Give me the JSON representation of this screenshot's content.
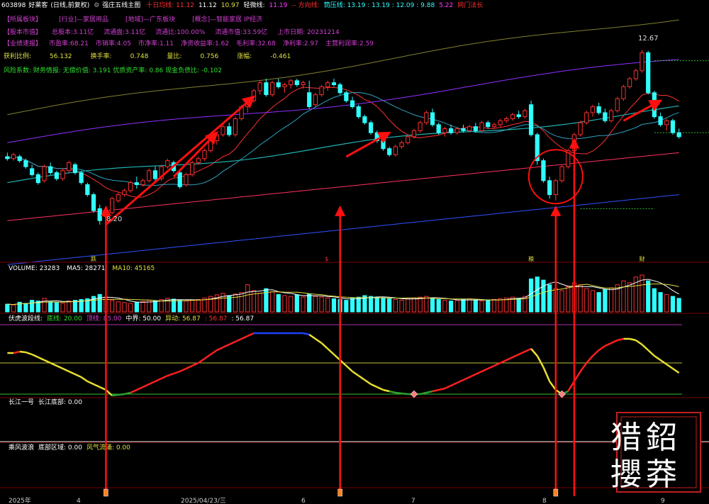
{
  "header": {
    "code": "603898",
    "name": "好莱客",
    "mode": "(日线,前复权)",
    "indicator": "强庄五线主图",
    "ma_items": [
      {
        "text": "十日均线: 11.12",
        "color": "#ff3030"
      },
      {
        "text": "11.12",
        "color": "#ffffff"
      },
      {
        "text": "10.97",
        "color": "#e0e040"
      },
      {
        "text": "轻微线:",
        "color": "#ffffff"
      },
      {
        "text": "11.19",
        "color": "#ff40ff"
      },
      {
        "text": "-- 方向线:",
        "color": "#ff3030"
      },
      {
        "text": "筒压线: 13.19 : 13.19 : 12.09 : 9.88",
        "color": "#30ffff"
      },
      {
        "text": "5.22",
        "color": "#ff40ff"
      },
      {
        "text": "网门法长",
        "color": "#ff3030"
      }
    ]
  },
  "info_rows": [
    [
      {
        "text": "【所属板块】",
        "color": "#d040d0"
      },
      {
        "text": "[行业]—家居用品",
        "color": "#d040d0"
      },
      {
        "text": "[地域]—广东板块",
        "color": "#d040d0"
      },
      {
        "text": "[概念]—智能家居 IP经济",
        "color": "#d040d0"
      }
    ],
    [
      {
        "text": "【股本市值】",
        "color": "#d040d0"
      },
      {
        "text": "总股本:3.11亿",
        "color": "#d040d0"
      },
      {
        "text": "流通盘:3.11亿",
        "color": "#d040d0"
      },
      {
        "text": "流通比:100.00%",
        "color": "#d040d0"
      },
      {
        "text": "流通市值:33.59亿",
        "color": "#d040d0"
      },
      {
        "text": "上市日期: 20231214",
        "color": "#d040d0"
      }
    ],
    [
      {
        "text": "【业绩速报】",
        "color": "#d040d0"
      },
      {
        "text": "市盈率:68.21",
        "color": "#d040d0"
      },
      {
        "text": "市销率:4.05",
        "color": "#d040d0"
      },
      {
        "text": "市净率:1.11",
        "color": "#d040d0"
      },
      {
        "text": "净资收益率:1.62",
        "color": "#d040d0"
      },
      {
        "text": "毛利率:32.68",
        "color": "#d040d0"
      },
      {
        "text": "净利率:2.97",
        "color": "#d040d0"
      },
      {
        "text": "主营利润率:2.59",
        "color": "#d040d0"
      }
    ],
    [
      {
        "text": "获利比例:",
        "color": "#e0e040"
      },
      {
        "text": "56.132",
        "color": "#e0e040"
      },
      {
        "text": "换手率:",
        "color": "#e0e040"
      },
      {
        "text": "0.748",
        "color": "#e0e040"
      },
      {
        "text": "量比:",
        "color": "#e0e040"
      },
      {
        "text": "0.756",
        "color": "#e0e040"
      },
      {
        "text": "涨幅:",
        "color": "#e0e040"
      },
      {
        "text": "-0.461",
        "color": "#e0e040"
      }
    ],
    [
      {
        "text": "风险系数: 财务情报: 无偿价值: 3.191 优质资产率: 0.86 现金负债比: -0.102",
        "color": "#30e030"
      }
    ]
  ],
  "price_labels": {
    "high": "12.67",
    "low": "8.20"
  },
  "volume_header": [
    {
      "text": "VOLUME: 23283",
      "color": "#ffffff"
    },
    {
      "text": "MA5: 28271",
      "color": "#ffffff"
    },
    {
      "text": "MA10: 45165",
      "color": "#e0e040"
    }
  ],
  "osc_header": [
    {
      "text": "伏虎波段线:",
      "color": "#ffffff"
    },
    {
      "text": "底线: 20.00",
      "color": "#30e030"
    },
    {
      "text": "顶线: 85.00",
      "color": "#d040d0"
    },
    {
      "text": "中界: 50.00",
      "color": "#ffffff"
    },
    {
      "text": "异动: 56.87",
      "color": "#e0e040"
    },
    {
      "text": ": 56.87",
      "color": "#ff3030"
    },
    {
      "text": ": 56.87",
      "color": "#ffffff"
    }
  ],
  "panel4_header": [
    {
      "text": "长江一号",
      "color": "#ffffff"
    },
    {
      "text": "长江底部: 0.00",
      "color": "#ffffff"
    }
  ],
  "panel5_header": [
    {
      "text": "乘风波浪",
      "color": "#ffffff"
    },
    {
      "text": "底部区域: 0.00",
      "color": "#ffffff"
    },
    {
      "text": "风气流涌: 0.00",
      "color": "#e0e040"
    }
  ],
  "x_axis": [
    {
      "label": "2025年",
      "pos": 0.012
    },
    {
      "label": "4",
      "pos": 0.108
    },
    {
      "label": "2025/04/23/三",
      "pos": 0.255
    },
    {
      "label": "6",
      "pos": 0.425
    },
    {
      "label": "7",
      "pos": 0.58
    },
    {
      "label": "8",
      "pos": 0.765
    },
    {
      "label": "9",
      "pos": 0.932
    }
  ],
  "markers": [
    "跌",
    "$",
    "粮",
    "财"
  ],
  "watermark": {
    "chars": [
      "鉊",
      "猎",
      "莽",
      "攖"
    ]
  },
  "colors": {
    "up": "#ff3030",
    "down": "#30ffff",
    "ma10": "#ff3030",
    "ma20": "#30a0c0",
    "ma60": "#20b0b0",
    "ma120": "#ff3060",
    "ma250": "#3050ff",
    "upper": "#9030ff",
    "top": "#808030"
  },
  "chart_data": {
    "type": "candlestick",
    "ylim": [
      7.5,
      13.6
    ],
    "series": [
      {
        "name": "price",
        "ohlc": [
          [
            10.0,
            10.1,
            9.9,
            9.95
          ],
          [
            9.95,
            10.1,
            9.9,
            10.05
          ],
          [
            10.0,
            10.05,
            9.85,
            9.9
          ],
          [
            9.9,
            9.95,
            9.7,
            9.75
          ],
          [
            9.7,
            9.8,
            9.5,
            9.55
          ],
          [
            9.55,
            9.6,
            9.3,
            9.35
          ],
          [
            9.4,
            9.8,
            9.35,
            9.75
          ],
          [
            9.75,
            9.85,
            9.55,
            9.6
          ],
          [
            9.6,
            9.65,
            9.4,
            9.45
          ],
          [
            9.45,
            9.7,
            9.4,
            9.65
          ],
          [
            9.65,
            9.9,
            9.6,
            9.85
          ],
          [
            9.8,
            9.85,
            9.55,
            9.6
          ],
          [
            9.6,
            9.65,
            9.3,
            9.35
          ],
          [
            9.3,
            9.35,
            9.0,
            9.05
          ],
          [
            9.05,
            9.1,
            8.6,
            8.65
          ],
          [
            8.7,
            8.8,
            8.3,
            8.4
          ],
          [
            8.5,
            8.7,
            8.2,
            8.6
          ],
          [
            8.6,
            9.0,
            8.55,
            8.95
          ],
          [
            8.9,
            9.1,
            8.85,
            9.05
          ],
          [
            9.05,
            9.2,
            9.0,
            9.15
          ],
          [
            9.15,
            9.4,
            9.1,
            9.35
          ],
          [
            9.35,
            9.5,
            9.2,
            9.3
          ],
          [
            9.3,
            9.45,
            9.25,
            9.4
          ],
          [
            9.4,
            9.7,
            9.35,
            9.65
          ],
          [
            9.65,
            9.75,
            9.4,
            9.45
          ],
          [
            9.45,
            9.8,
            9.4,
            9.75
          ],
          [
            9.75,
            9.95,
            9.7,
            9.9
          ],
          [
            9.85,
            9.9,
            9.6,
            9.65
          ],
          [
            9.6,
            9.65,
            9.2,
            9.25
          ],
          [
            9.3,
            9.6,
            9.25,
            9.55
          ],
          [
            9.55,
            9.9,
            9.5,
            9.85
          ],
          [
            9.85,
            10.0,
            9.8,
            9.95
          ],
          [
            9.95,
            10.2,
            9.9,
            10.15
          ],
          [
            10.15,
            10.45,
            10.1,
            10.4
          ],
          [
            10.4,
            10.6,
            10.3,
            10.55
          ],
          [
            10.55,
            10.8,
            10.5,
            10.75
          ],
          [
            10.75,
            10.85,
            10.5,
            10.55
          ],
          [
            10.55,
            11.0,
            10.5,
            10.95
          ],
          [
            10.95,
            11.3,
            10.9,
            11.25
          ],
          [
            11.25,
            11.45,
            11.1,
            11.4
          ],
          [
            11.4,
            11.7,
            11.35,
            11.65
          ],
          [
            11.65,
            11.9,
            11.55,
            11.85
          ],
          [
            11.85,
            11.95,
            11.5,
            11.55
          ],
          [
            11.55,
            11.9,
            11.5,
            11.85
          ],
          [
            11.85,
            11.95,
            11.7,
            11.75
          ],
          [
            11.75,
            11.85,
            11.6,
            11.8
          ],
          [
            11.8,
            11.95,
            11.7,
            11.9
          ],
          [
            11.9,
            11.95,
            11.75,
            11.8
          ],
          [
            11.8,
            11.9,
            11.7,
            11.85
          ],
          [
            11.6,
            11.9,
            11.2,
            11.25
          ],
          [
            11.3,
            11.6,
            11.25,
            11.55
          ],
          [
            11.55,
            11.8,
            11.5,
            11.75
          ],
          [
            11.75,
            11.9,
            11.65,
            11.85
          ],
          [
            11.85,
            11.95,
            11.75,
            11.8
          ],
          [
            11.8,
            11.85,
            11.55,
            11.6
          ],
          [
            11.6,
            11.65,
            11.35,
            11.4
          ],
          [
            11.4,
            11.5,
            11.2,
            11.25
          ],
          [
            11.25,
            11.3,
            10.95,
            11.0
          ],
          [
            11.0,
            11.05,
            10.8,
            10.85
          ],
          [
            10.85,
            10.9,
            10.55,
            10.6
          ],
          [
            10.6,
            10.65,
            10.35,
            10.4
          ],
          [
            10.4,
            10.45,
            10.15,
            10.2
          ],
          [
            10.2,
            10.25,
            10.0,
            10.05
          ],
          [
            10.05,
            10.3,
            10.0,
            10.25
          ],
          [
            10.25,
            10.4,
            10.2,
            10.35
          ],
          [
            10.35,
            10.55,
            10.3,
            10.5
          ],
          [
            10.5,
            10.7,
            10.45,
            10.65
          ],
          [
            10.65,
            10.9,
            10.6,
            10.85
          ],
          [
            10.85,
            11.15,
            10.8,
            11.1
          ],
          [
            11.1,
            11.2,
            10.75,
            10.8
          ],
          [
            10.8,
            10.85,
            10.55,
            10.6
          ],
          [
            10.6,
            10.75,
            10.5,
            10.7
          ],
          [
            10.7,
            10.8,
            10.55,
            10.6
          ],
          [
            10.6,
            10.75,
            10.55,
            10.7
          ],
          [
            10.7,
            10.8,
            10.6,
            10.65
          ],
          [
            10.65,
            10.8,
            10.6,
            10.75
          ],
          [
            10.75,
            10.85,
            10.6,
            10.65
          ],
          [
            10.65,
            10.9,
            10.6,
            10.85
          ],
          [
            10.85,
            10.9,
            10.7,
            10.75
          ],
          [
            10.75,
            10.85,
            10.7,
            10.8
          ],
          [
            10.8,
            10.95,
            10.75,
            10.9
          ],
          [
            10.9,
            11.0,
            10.85,
            10.95
          ],
          [
            10.95,
            11.1,
            10.9,
            11.05
          ],
          [
            11.05,
            11.15,
            10.95,
            11.0
          ],
          [
            11.0,
            11.2,
            10.95,
            11.15
          ],
          [
            11.3,
            11.4,
            10.5,
            10.55
          ],
          [
            10.55,
            10.6,
            9.8,
            9.9
          ],
          [
            9.9,
            9.95,
            9.35,
            9.4
          ],
          [
            9.4,
            9.5,
            8.95,
            9.05
          ],
          [
            9.05,
            9.45,
            8.9,
            9.4
          ],
          [
            9.4,
            9.8,
            9.35,
            9.75
          ],
          [
            9.75,
            10.2,
            9.7,
            10.15
          ],
          [
            10.15,
            10.6,
            10.1,
            10.55
          ],
          [
            10.55,
            10.9,
            10.5,
            10.85
          ],
          [
            10.85,
            11.15,
            10.8,
            11.1
          ],
          [
            11.1,
            11.3,
            11.0,
            11.25
          ],
          [
            11.25,
            11.35,
            11.05,
            11.1
          ],
          [
            11.1,
            11.2,
            10.85,
            10.9
          ],
          [
            10.9,
            11.2,
            10.85,
            11.15
          ],
          [
            11.15,
            11.5,
            11.1,
            11.45
          ],
          [
            11.45,
            11.8,
            11.4,
            11.75
          ],
          [
            11.75,
            12.0,
            11.7,
            11.95
          ],
          [
            11.95,
            12.2,
            11.9,
            12.15
          ],
          [
            12.15,
            12.67,
            12.1,
            12.6
          ],
          [
            12.6,
            12.65,
            11.55,
            11.6
          ],
          [
            11.6,
            11.65,
            10.95,
            11.0
          ],
          [
            11.0,
            11.1,
            10.75,
            10.8
          ],
          [
            10.8,
            10.95,
            10.65,
            10.9
          ],
          [
            10.9,
            10.95,
            10.55,
            10.6
          ],
          [
            10.6,
            10.7,
            10.45,
            10.5
          ]
        ]
      },
      {
        "name": "volume",
        "values": [
          20,
          18,
          25,
          22,
          30,
          28,
          35,
          26,
          24,
          22,
          28,
          30,
          32,
          34,
          40,
          45,
          38,
          30,
          26,
          24,
          22,
          25,
          27,
          30,
          28,
          32,
          35,
          33,
          30,
          28,
          30,
          32,
          36,
          40,
          44,
          48,
          42,
          46,
          50,
          70,
          55,
          48,
          60,
          52,
          45,
          42,
          40,
          44,
          38,
          46,
          40,
          38,
          36,
          34,
          32,
          30,
          35,
          38,
          42,
          40,
          38,
          36,
          34,
          32,
          30,
          34,
          36,
          38,
          40,
          35,
          32,
          30,
          28,
          30,
          32,
          34,
          30,
          28,
          30,
          32,
          34,
          36,
          38,
          35,
          40,
          85,
          90,
          82,
          70,
          60,
          55,
          65,
          75,
          70,
          60,
          55,
          50,
          58,
          62,
          70,
          80,
          75,
          90,
          95,
          80,
          60,
          50,
          45,
          40,
          35
        ]
      },
      {
        "name": "oscillator",
        "values": [
          60,
          60,
          62,
          61,
          58,
          54,
          50,
          46,
          42,
          38,
          34,
          30,
          26,
          20,
          16,
          12,
          8,
          0,
          1,
          2,
          4,
          8,
          12,
          16,
          20,
          24,
          28,
          31,
          34,
          38,
          42,
          46,
          52,
          58,
          64,
          68,
          72,
          76,
          80,
          84,
          88,
          88,
          88,
          88,
          88,
          88,
          88,
          88,
          88,
          86,
          80,
          74,
          66,
          58,
          50,
          42,
          34,
          28,
          22,
          16,
          12,
          8,
          6,
          4,
          3,
          2,
          2,
          2,
          4,
          6,
          8,
          10,
          14,
          18,
          22,
          26,
          30,
          34,
          38,
          42,
          46,
          50,
          54,
          58,
          62,
          66,
          56,
          40,
          20,
          8,
          2,
          6,
          20,
          34,
          46,
          56,
          64,
          70,
          74,
          78,
          80,
          80,
          78,
          72,
          64,
          56,
          50,
          44,
          38,
          32
        ]
      }
    ]
  }
}
